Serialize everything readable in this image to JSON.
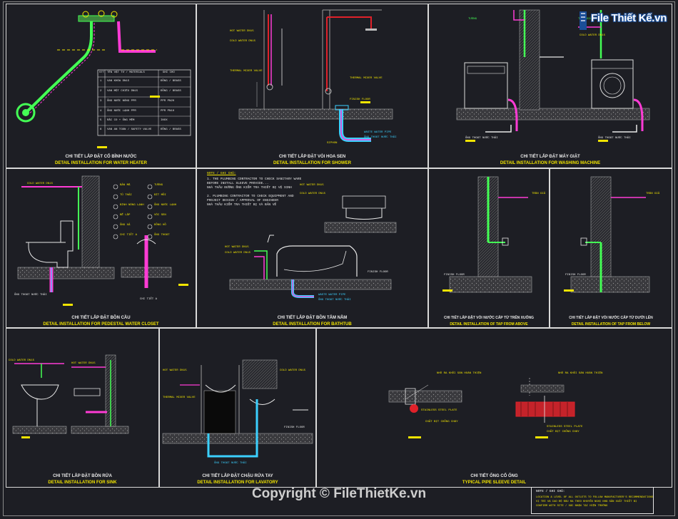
{
  "watermark": {
    "logo_text": "File Thiết Kế.vn",
    "copyright": "Copyright © FileThietKe.vn"
  },
  "panels": [
    {
      "id": "p1",
      "vn": "CHI TIẾT LẮP ĐẶT CỔ BÌNH NƯỚC",
      "en": "DETAIL INSTALLATION FOR WATER HEATER"
    },
    {
      "id": "p2",
      "vn": "CHI TIẾT LẮP ĐẶT VÒI HOA SEN",
      "en": "DETAIL INSTALLATION FOR SHOWER"
    },
    {
      "id": "p3",
      "vn": "CHI TIẾT LẮP ĐẶT MÁY GIẶT",
      "en": "DETAIL INSTALLATION FOR WASHING MACHINE"
    },
    {
      "id": "p4",
      "vn": "CHI TIẾT LẮP ĐẶT BỒN CẦU",
      "en": "DETAIL INSTALLATION FOR PEDESTAL WATER CLOSET"
    },
    {
      "id": "p5",
      "vn": "CHI TIẾT LẮP ĐẶT BỒN TẮM NẰM",
      "en": "DETAIL INSTALLATION FOR BATHTUB"
    },
    {
      "id": "p6",
      "vn": "CHI TIẾT LẮP ĐẶT VÒI NƯỚC CẤP TỪ TRÊN XUỐNG",
      "en": "DETAIL INSTALLATION OF TAP FROM ABOVE"
    },
    {
      "id": "p7",
      "vn": "CHI TIẾT LẮP ĐẶT VÒI NƯỚC CẤP TỪ DƯỚI LÊN",
      "en": "DETAIL INSTALLATION OF TAP FROM BELOW"
    },
    {
      "id": "p8",
      "vn": "CHI TIẾT LẮP ĐẶT BỒN RỬA",
      "en": "DETAIL INSTALLATION FOR SINK"
    },
    {
      "id": "p9",
      "vn": "CHI TIẾT LẮP ĐẶT CHẬU RỬA TAY",
      "en": "DETAIL INSTALLATION FOR LAVATORY"
    },
    {
      "id": "p10",
      "vn": "CHI TIẾT ỐNG CỔ ỐNG",
      "en": "TYPICAL PIPE SLEEVE DETAIL"
    }
  ],
  "labels": {
    "hot_water": "HOT WATER DN15",
    "cold_water": "COLD WATER DN15",
    "waste_pipe": "WASTE WATER PIPE",
    "drain": "ỐNG THOÁT NƯỚC THẢI",
    "finish_floor": "FINISH FLOOR",
    "thermal_valve": "THERMAL MIXER VALVE",
    "trap": "SIPHON",
    "detail_a": "CHI TIẾT A",
    "wall": "TƯỜNG",
    "ceiling": "TRẦN GIẢ",
    "sleeve_note": "NHÔ RA KHỎI SÀN HOÀN THIỆN",
    "stainless": "STAINLESS STEEL PLATE",
    "fire_seal": "CHẤT BỊT CHỐNG CHÁY"
  },
  "bathtub_note": {
    "title": "NOTE / GHI CHÚ:",
    "lines": [
      "1. THE PLUMBING CONTRACTOR TO CHECK SANITARY WARE",
      "   BEFORE INSTALL SLEEVE PROVIDE...",
      "   NHÀ THẦU ĐƯỜNG ỐNG KIỂM TRA THIẾT BỊ VỆ SINH",
      "2. PLUMBING CONTRACTOR TO CHECK EQUIPMENT AND",
      "   PROJECT DESIGN / APPROVAL OF ENGINEER",
      "   NHÀ THẦU KIỂM TRA THIẾT BỊ VÀ BẢN VẼ"
    ]
  },
  "legend_table": {
    "headers": [
      "STT",
      "TÊN VẬT TƯ / MATERIALS",
      "GHI CHÚ"
    ],
    "rows": [
      [
        "1",
        "VAN KHÓA DN15",
        "ĐỒNG / BRASS"
      ],
      [
        "2",
        "VAN MỘT CHIỀU DN15",
        "ĐỒNG / BRASS"
      ],
      [
        "3",
        "ỐNG NƯỚC NÓNG PPR",
        "PPR PN20"
      ],
      [
        "4",
        "ỐNG NƯỚC LẠNH PPR",
        "PPR PN10"
      ],
      [
        "5",
        "RẮC CO + ỐNG MỀM",
        "INOX"
      ],
      [
        "6",
        "VAN AN TOÀN / SAFETY VALVE",
        "ĐỒNG / BRASS"
      ]
    ]
  },
  "wc_legend": [
    [
      "BẢN MÃ",
      "TƯỜNG"
    ],
    [
      "TỦ THẢI",
      "BÍT MỒI"
    ],
    [
      "BÌNH NÓNG LẠNH",
      "ỐNG NƯỚC LẠNH"
    ],
    [
      "BỂ LẮP",
      "VÒI SEN"
    ],
    [
      "ỐNG XẢ",
      "ĐỒNG HỒ"
    ],
    [
      "CHI TIẾT A",
      "ỐNG THOÁT"
    ]
  ],
  "notes_box": {
    "title": "NOTE / GHI CHÚ:",
    "body": [
      "LOCATION & LEVEL OF ALL OUTLETS TO FOLLOW MANUFACTURER'S RECOMMENDATIONS",
      "VỊ TRÍ VÀ CAO ĐỘ ĐẦU RA THEO KHUYẾN NGHỊ NHÀ SẢN XUẤT THIẾT BỊ",
      "CONFIRM WITH SITE / XÁC NHẬN TẠI HIỆN TRƯỜNG"
    ]
  },
  "colors": {
    "hot": "#ff3bd5",
    "cold": "#44ff55",
    "drain": "#3bd0ff",
    "label_bg": "#f1e400",
    "pipe_red": "#e0212a"
  }
}
